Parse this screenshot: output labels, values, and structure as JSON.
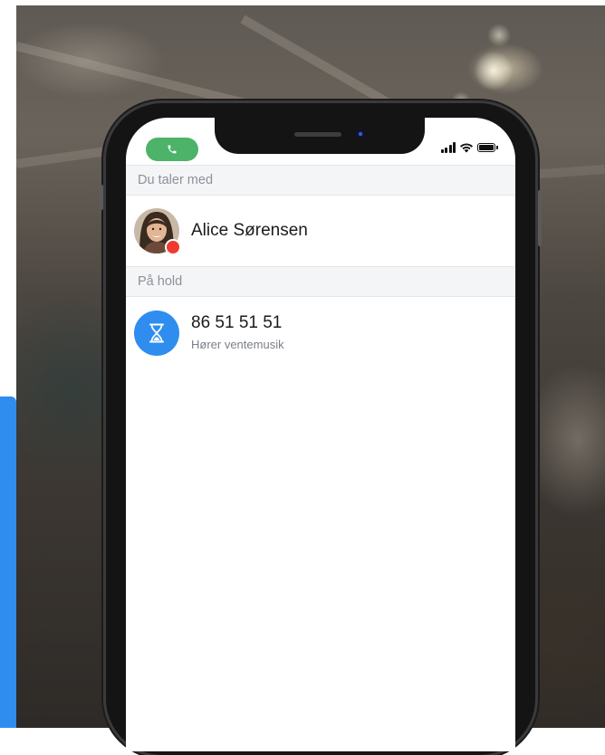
{
  "status_bar": {
    "call_icon": "phone-icon",
    "signal_icon": "cellular-signal-icon",
    "wifi_icon": "wifi-icon",
    "battery_icon": "battery-icon"
  },
  "active_section": {
    "header": "Du taler med",
    "contact": {
      "name": "Alice Sørensen",
      "presence": "busy",
      "presence_color": "#ef3b2f"
    }
  },
  "hold_section": {
    "header": "På hold",
    "call": {
      "number": "86 51 51 51",
      "status": "Hører ventemusik",
      "icon": "hourglass-icon"
    }
  },
  "colors": {
    "accent_blue": "#2f8df0",
    "call_green": "#4cb368",
    "presence_red": "#ef3b2f"
  }
}
